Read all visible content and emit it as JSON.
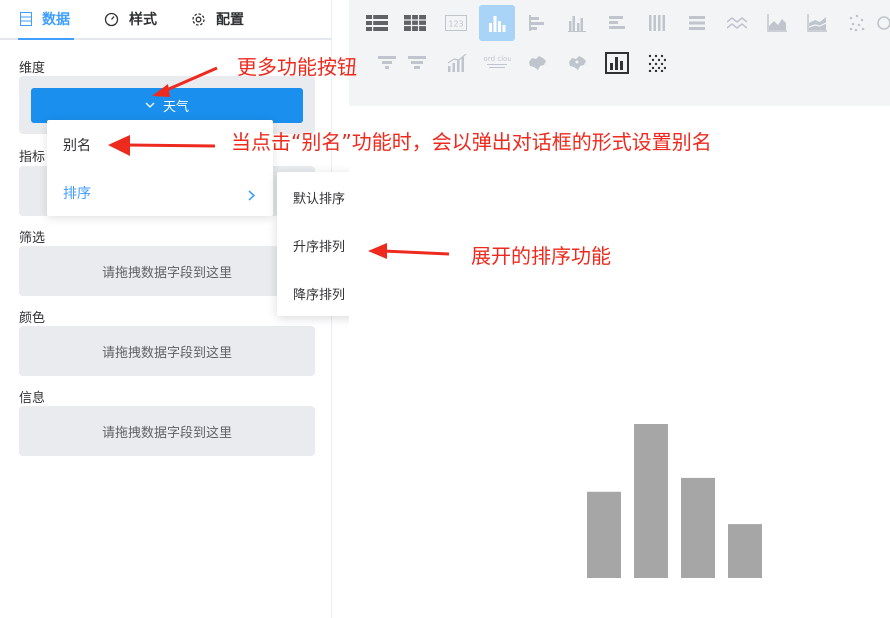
{
  "tabs": [
    {
      "label": "数据",
      "icon": "table-icon",
      "active": true
    },
    {
      "label": "样式",
      "icon": "gauge-icon",
      "active": false
    },
    {
      "label": "配置",
      "icon": "gear-icon",
      "active": false
    }
  ],
  "sections": {
    "dimension": "维度",
    "metric": "指标",
    "filter": "筛选",
    "color": "颜色",
    "info": "信息"
  },
  "dimension_field": "天气",
  "drop_placeholder": "请拖拽数据字段到这里",
  "menu": {
    "alias": "别名",
    "sort": "排序"
  },
  "submenu": [
    "默认排序",
    "升序排列",
    "降序排列"
  ],
  "annotations": {
    "more": "更多功能按钮",
    "alias_note": "当点击“别名”功能时，会以弹出对话框的形式设置别名",
    "sort_note": "展开的排序功能"
  },
  "chart_icons_row1": [
    "table-icon",
    "cross-table-icon",
    "number-card-icon",
    "bar-chart-icon",
    "horizontal-bar-icon",
    "grouped-bar-icon",
    "stacked-horizontal-bar-icon",
    "stacked-bar-icon",
    "percent-horizontal-bar-icon",
    "line-chart-icon",
    "area-chart-icon",
    "stacked-area-icon",
    "scatter-icon",
    "pie-icon"
  ],
  "chart_icons_row2": [
    "funnel-icon",
    "funnel-icon",
    "waterfall-icon",
    "word-cloud-icon",
    "china-map-icon",
    "china-map-bubble-icon",
    "bar-preview-icon",
    "dot-matrix-icon"
  ],
  "word_cloud_text": "word cloud",
  "colors": {
    "accent": "#409eff",
    "pill": "#1a8fee",
    "annotation": "#ee2a1e",
    "preview_bar": "#a6a6a6"
  },
  "preview_bars": [
    0.56,
    1.0,
    0.65,
    0.35
  ]
}
